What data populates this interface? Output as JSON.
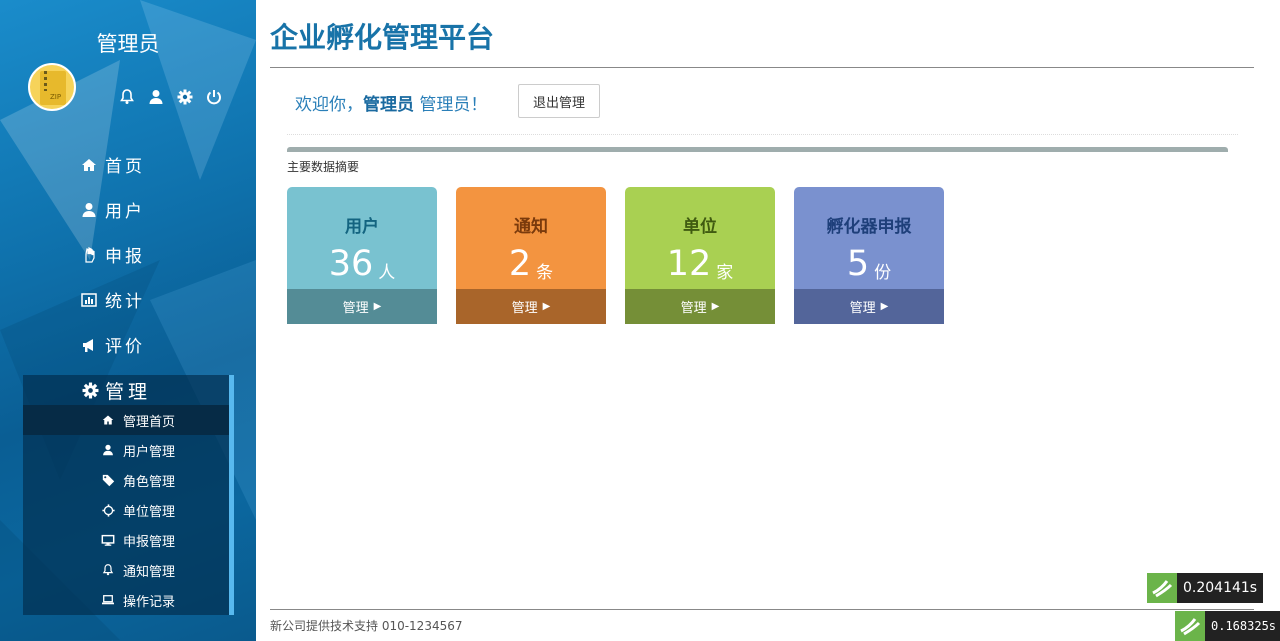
{
  "sidebar": {
    "admin_name": "管理员",
    "top_icons": [
      "bell-icon",
      "user-icon",
      "gear-icon",
      "power-icon"
    ],
    "nav": [
      {
        "label": "首页",
        "icon": "home-icon"
      },
      {
        "label": "用户",
        "icon": "user-icon"
      },
      {
        "label": "申报",
        "icon": "hand-icon"
      },
      {
        "label": "统计",
        "icon": "bar-chart-icon"
      },
      {
        "label": "评价",
        "icon": "bullhorn-icon"
      }
    ],
    "manage": {
      "label": "管理",
      "icon": "gear-icon",
      "items": [
        {
          "label": "管理首页",
          "icon": "home-icon",
          "active": true
        },
        {
          "label": "用户管理",
          "icon": "user-icon"
        },
        {
          "label": "角色管理",
          "icon": "tags-icon"
        },
        {
          "label": "单位管理",
          "icon": "cog-outline-icon"
        },
        {
          "label": "申报管理",
          "icon": "desktop-icon"
        },
        {
          "label": "通知管理",
          "icon": "bell-icon"
        },
        {
          "label": "操作记录",
          "icon": "laptop-icon"
        }
      ]
    }
  },
  "header": {
    "title": "企业孵化管理平台"
  },
  "welcome": {
    "prefix": "欢迎你，",
    "name": "管理员",
    "role": "管理员",
    "suffix": "！"
  },
  "logout_label": "退出管理",
  "summary_label": "主要数据摘要",
  "cards": [
    {
      "name": "用户",
      "count": "36",
      "unit": "人",
      "action": "管理",
      "color": "#79c2d0"
    },
    {
      "name": "通知",
      "count": "2",
      "unit": "条",
      "action": "管理",
      "color": "#f39440"
    },
    {
      "name": "单位",
      "count": "12",
      "unit": "家",
      "action": "管理",
      "color": "#a9d052"
    },
    {
      "name": "孵化器申报",
      "count": "5",
      "unit": "份",
      "action": "管理",
      "color": "#7a91cf"
    }
  ],
  "footer": {
    "text": "新公司提供技术支持 010-1234567"
  },
  "timers": [
    "0.204141s",
    "0.168325s"
  ]
}
